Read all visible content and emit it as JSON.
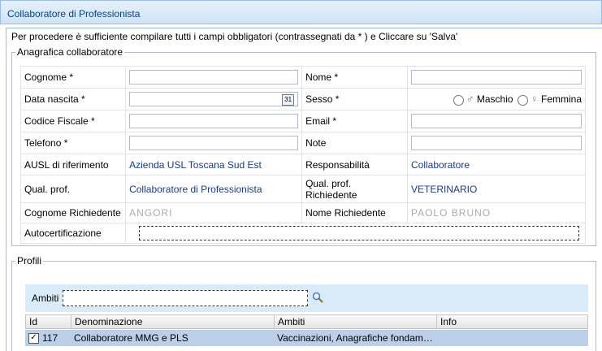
{
  "window": {
    "title": "Collaboratore di Professionista"
  },
  "instructions": "Per procedere è sufficiente compilare tutti i campi obbligatori (contrassegnati da * ) e Cliccare su 'Salva'",
  "anagrafica": {
    "legend": "Anagrafica collaboratore",
    "cognome_label": "Cognome *",
    "nome_label": "Nome *",
    "data_nascita_label": "Data nascita *",
    "sesso_label": "Sesso *",
    "maschio_label": "Maschio",
    "femmina_label": "Femmina",
    "codice_fiscale_label": "Codice Fiscale *",
    "email_label": "Email *",
    "telefono_label": "Telefono *",
    "note_label": "Note",
    "ausl_label": "AUSL di riferimento",
    "ausl_value": "Azienda USL Toscana Sud Est",
    "responsabilita_label": "Responsabilità",
    "responsabilita_value": "Collaboratore",
    "qual_prof_label": "Qual. prof.",
    "qual_prof_value": "Collaboratore di Professionista",
    "qual_prof_rich_label": "Qual. prof. Richiedente",
    "qual_prof_rich_value": "VETERINARIO",
    "cognome_rich_label": "Cognome Richiedente",
    "cognome_rich_value": "ANGORI",
    "nome_rich_label": "Nome Richiedente",
    "nome_rich_value": "PAOLO BRUNO",
    "autocert_label": "Autocertificazione",
    "calendar_icon_text": "31"
  },
  "profili": {
    "legend": "Profili",
    "ambiti_label": "Ambiti",
    "columns": [
      "Id",
      "Denominazione",
      "Ambiti",
      "Info"
    ],
    "rows": [
      {
        "checked": true,
        "id": "117",
        "denominazione": "Collaboratore MMG e PLS",
        "ambiti": "Vaccinazioni, Anagrafiche fondam…",
        "info": ""
      }
    ]
  },
  "colors": {
    "accent": "#04408c",
    "link": "#1a3b8a",
    "selected_row": "#bccfe8",
    "ambiti_bar": "#d9ebf9"
  }
}
